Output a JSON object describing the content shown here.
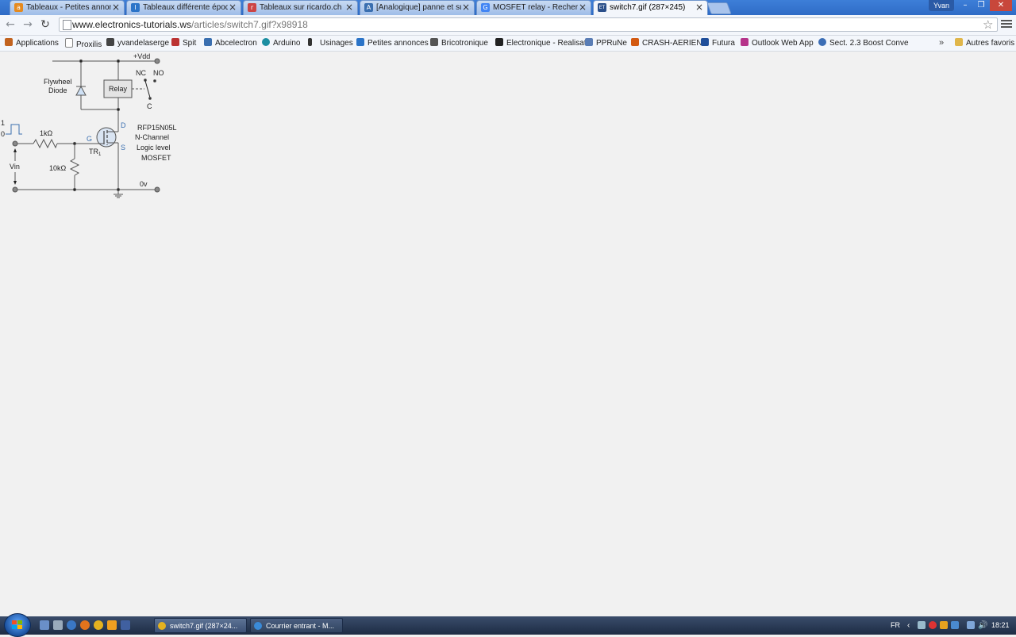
{
  "tabs": [
    {
      "title": "Tableaux - Petites annonces",
      "icon_color": "#e58a1f",
      "icon_glyph": "a"
    },
    {
      "title": "Tableaux différente époque",
      "icon_color": "#2b74c8",
      "icon_glyph": "l"
    },
    {
      "title": "Tableaux sur ricardo.ch",
      "icon_color": "#c44",
      "icon_glyph": "r"
    },
    {
      "title": "[Analogique] panne et sur",
      "icon_color": "#3a6fb0",
      "icon_glyph": "A"
    },
    {
      "title": "MOSFET relay - Recherche",
      "icon_color": "#4285f4",
      "icon_glyph": "G"
    },
    {
      "title": "switch7.gif (287×245)",
      "icon_color": "#2a4f8a",
      "icon_glyph": "ET"
    }
  ],
  "window": {
    "user": "Yvan"
  },
  "omnibox": {
    "host": "www.electronics-tutorials.ws",
    "path": "/articles/switch7.gif?x98918"
  },
  "bookmarks": [
    {
      "label": "Applications",
      "icon_color": "#c2631f"
    },
    {
      "label": "Proxilis",
      "icon_color": "#888"
    },
    {
      "label": "yvandelaserge",
      "icon_color": "#444"
    },
    {
      "label": "Spit",
      "icon_color": "#b33"
    },
    {
      "label": "Abcelectron",
      "icon_color": "#3a6fb0"
    },
    {
      "label": "Arduino",
      "icon_color": "#1b8ea2"
    },
    {
      "label": "Usinages",
      "icon_color": "#333"
    },
    {
      "label": "Petites annonces",
      "icon_color": "#2b74c8"
    },
    {
      "label": "Bricotronique",
      "icon_color": "#555"
    },
    {
      "label": "Electronique - Realisat",
      "icon_color": "#222"
    },
    {
      "label": "PPRuNe",
      "icon_color": "#5a7db5"
    },
    {
      "label": "CRASH-AERIEN",
      "icon_color": "#d35a12"
    },
    {
      "label": "Futura",
      "icon_color": "#1f4e9a"
    },
    {
      "label": "Outlook Web App",
      "icon_color": "#b5338a"
    },
    {
      "label": "Sect. 2.3 Boost Conve",
      "icon_color": "#3b6db5"
    },
    {
      "label": "Autres favoris",
      "icon_color": "#e0b64a"
    }
  ],
  "diagram": {
    "vdd_label": "+Vdd",
    "nc_label": "NC",
    "no_label": "NO",
    "c_label": "C",
    "relay_label": "Relay",
    "flywheel_label_1": "Flywheel",
    "flywheel_label_2": "Diode",
    "d_label": "D",
    "g_label": "G",
    "s_label": "S",
    "tr_label": "TR",
    "tr_sub": "1",
    "part_line1": "RFP15N05L",
    "part_line2": "N-Channel",
    "part_line3": "Logic level",
    "part_line4": "MOSFET",
    "r1_label": "1kΩ",
    "r2_label": "10kΩ",
    "vin_label": "Vin",
    "zero_v_label": "0v",
    "pulse_high": "1",
    "pulse_low": "0"
  },
  "taskbar": {
    "buttons": [
      {
        "label": "switch7.gif (287×24...",
        "icon_color": "#e5b21f"
      },
      {
        "label": "Courrier entrant - M...",
        "icon_color": "#3a8ad8"
      }
    ],
    "lang": "FR",
    "clock": "18:21"
  }
}
